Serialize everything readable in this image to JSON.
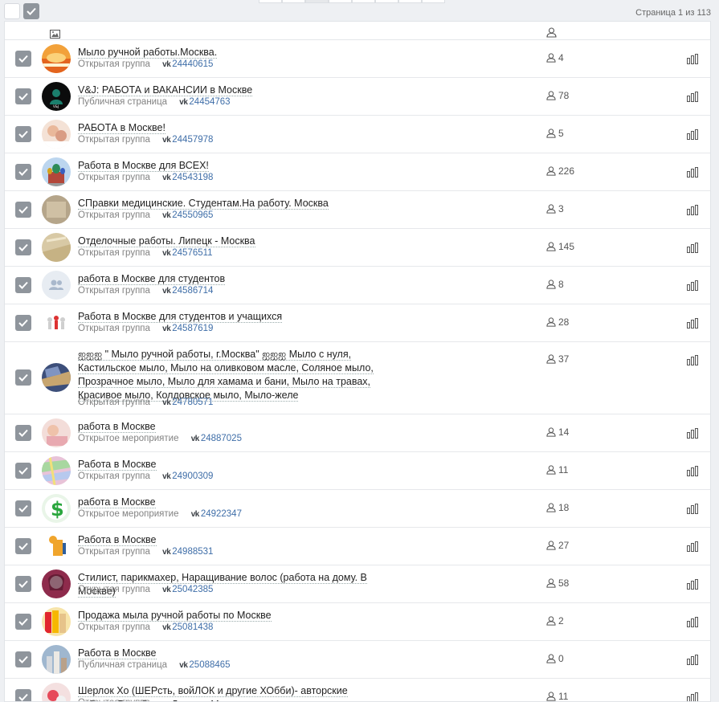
{
  "pagination": {
    "info": "Страница 1 из 113",
    "pages": 8,
    "active_index": 2
  },
  "columns": {
    "image_icon": "image-icon",
    "members_icon": "members-icon"
  },
  "rows": [
    {
      "title": "Мыло ручной работы.Москва.",
      "type": "Открытая группа",
      "id": "24440615",
      "members": "4",
      "avatar": "orange-sunset"
    },
    {
      "title": "V&J: РАБОТА и ВАКАНСИИ в Москве",
      "type": "Публичная страница",
      "id": "24454763",
      "members": "78",
      "avatar": "dark-logo"
    },
    {
      "title": "РАБОТА в Москве!",
      "type": "Открытая группа",
      "id": "24457978",
      "members": "5",
      "avatar": "photo-people"
    },
    {
      "title": "Работа в Москве для ВСЕХ!",
      "type": "Открытая группа",
      "id": "24543198",
      "members": "226",
      "avatar": "st-basil"
    },
    {
      "title": "СПравки медицинские. Студентам.На работу. Москва",
      "type": "Открытая группа",
      "id": "24550965",
      "members": "3",
      "avatar": "beige-paper"
    },
    {
      "title": "Отделочные работы. Липецк - Москва",
      "type": "Открытая группа",
      "id": "24576511",
      "members": "145",
      "avatar": "sand"
    },
    {
      "title": "работа в Москве для студентов",
      "type": "Открытая группа",
      "id": "24586714",
      "members": "8",
      "avatar": "default-group"
    },
    {
      "title": "Работа в Москве для студентов и учащихся",
      "type": "Открытая группа",
      "id": "24587619",
      "members": "28",
      "avatar": "figures"
    },
    {
      "title": "ஐஐஐ \" Мыло ручной работы, г.Москва\" ஐஐஐ Мыло с нуля, Кастильское мыло, Мыло на оливковом масле, Соляное мыло, Прозрачное мыло, Мыло для хамама и бани, Мыло на травах, Красивое мыло, Колдовское мыло, Мыло-желе",
      "type": "Открытая группа",
      "id": "24780571",
      "members": "37",
      "avatar": "soap",
      "tall": true
    },
    {
      "title": "работа в Москве",
      "type": "Открытое мероприятие",
      "id": "24887025",
      "members": "14",
      "avatar": "baby"
    },
    {
      "title": "Работа в Москве",
      "type": "Открытая группа",
      "id": "24900309",
      "members": "11",
      "avatar": "map"
    },
    {
      "title": "работа в Москве",
      "type": "Открытое мероприятие",
      "id": "24922347",
      "members": "18",
      "avatar": "dollar"
    },
    {
      "title": "Работа в Москве",
      "type": "Открытая группа",
      "id": "24988531",
      "members": "27",
      "avatar": "cartoon"
    },
    {
      "title": "Стилист, парикмахер, Наращивание волос (работа на дому. В Москве)",
      "type": "Открытая группа",
      "id": "25042385",
      "members": "58",
      "avatar": "stylist"
    },
    {
      "title": "Продажа мыла ручной работы по Москве",
      "type": "Открытая группа",
      "id": "25081438",
      "members": "2",
      "avatar": "soap-bars"
    },
    {
      "title": "Работа в Москве",
      "type": "Публичная страница",
      "id": "25088465",
      "members": "0",
      "avatar": "city"
    },
    {
      "title": "Шерлок Хо (ШЕРсть, войЛОК и другие ХОбби)- авторские работы. Воробьева Дарья, г.Москва",
      "type": "Открытая группа",
      "id": "",
      "members": "11",
      "avatar": "craft",
      "partial": true
    }
  ],
  "colors": {
    "checkbox": "#8f959c",
    "link": "#3f6ea8",
    "meta": "#828282"
  }
}
